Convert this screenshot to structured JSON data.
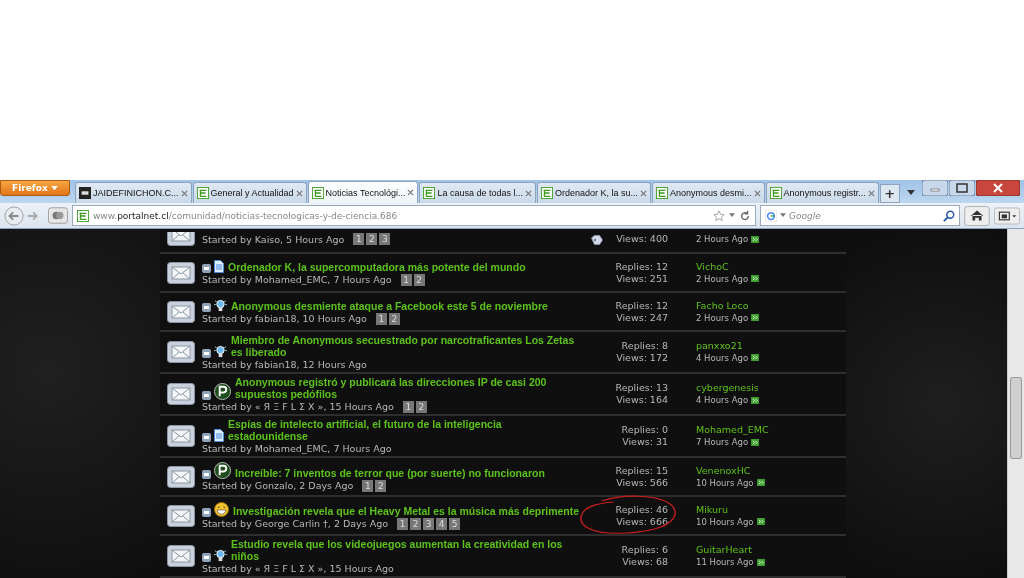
{
  "browser": {
    "menu_button": "Firefox",
    "tabs": [
      {
        "label": "JAIDEFINICHON.C...",
        "kind": "hd",
        "selected": false
      },
      {
        "label": "General y Actualidad",
        "kind": "site",
        "selected": false
      },
      {
        "label": "Noticias Tecnológi...",
        "kind": "site",
        "selected": true
      },
      {
        "label": "La causa de todas l...",
        "kind": "site",
        "selected": false
      },
      {
        "label": "Ordenador K, la su...",
        "kind": "site",
        "selected": false
      },
      {
        "label": "Anonymous desmi...",
        "kind": "site",
        "selected": false
      },
      {
        "label": "Anonymous registr...",
        "kind": "site",
        "selected": false
      }
    ],
    "new_tab": "+",
    "url": {
      "prefix": "www.",
      "domain": "portalnet.cl",
      "path": "/comunidad/noticias-tecnologicas-y-de-ciencia.686"
    },
    "search": {
      "placeholder": "Google"
    }
  },
  "threads": [
    {
      "kind": "cut",
      "starter": "Started by Kaiso, 5 Hours Ago",
      "pages": [
        "1",
        "2",
        "3"
      ],
      "tagged": true,
      "views": "Views: 400",
      "last_time": "2 Hours Ago",
      "circled": false
    },
    {
      "kind": "doc",
      "title": "Ordenador K, la supercomputadora más potente del mundo",
      "starter": "Started by Mohamed_EMC, 7 Hours Ago",
      "pages": [
        "1",
        "2"
      ],
      "tagged": false,
      "replies": "Replies: 12",
      "views": "Views: 251",
      "last_poster": "VichoC",
      "last_time": "2 Hours Ago",
      "circled": false
    },
    {
      "kind": "bulb",
      "title": "Anonymous desmiente ataque a Facebook este 5 de noviembre",
      "starter": "Started by fabian18, 10 Hours Ago",
      "pages": [
        "1",
        "2"
      ],
      "tagged": false,
      "replies": "Replies: 12",
      "views": "Views: 247",
      "last_poster": "Facho Loco",
      "last_time": "2 Hours Ago",
      "circled": false
    },
    {
      "kind": "bulb",
      "title": "Miembro de Anonymous secuestrado por narcotraficantes Los Zetas es liberado",
      "starter": "Started by fabian18, 12 Hours Ago",
      "tagged": false,
      "replies": "Replies: 8",
      "views": "Views: 172",
      "last_poster": "panxxo21",
      "last_time": "4 Hours Ago",
      "circled": false
    },
    {
      "kind": "p",
      "title": "Anonymous registró y publicará las direcciones IP de casi 200 supuestos pedófilos",
      "starter": "Started by « Я Ξ F L Σ Χ », 15 Hours Ago",
      "pages": [
        "1",
        "2"
      ],
      "tagged": false,
      "replies": "Replies: 13",
      "views": "Views: 164",
      "last_poster": "cybergenesis",
      "last_time": "4 Hours Ago",
      "circled": false
    },
    {
      "kind": "doc",
      "title": "Espías de intelecto artificial, el futuro de la inteligencia estadounidense",
      "starter": "Started by Mohamed_EMC, 7 Hours Ago",
      "tagged": false,
      "replies": "Replies: 0",
      "views": "Views: 31",
      "last_poster": "Mohamed_EMC",
      "last_time": "7 Hours Ago",
      "circled": false
    },
    {
      "kind": "p",
      "title": "Increíble: 7 inventos de terror que (por suerte) no funcionaron",
      "starter": "Started by Gonzalo, 2 Days Ago",
      "pages": [
        "1",
        "2"
      ],
      "tagged": false,
      "replies": "Replies: 15",
      "views": "Views: 566",
      "last_poster": "VenenoxHC",
      "last_time": "10 Hours Ago",
      "circled": false
    },
    {
      "kind": "laugh",
      "title": "Investigación revela que el Heavy Metal es la música más deprimente",
      "starter": "Started by George Carlin †, 2 Days Ago",
      "pages": [
        "1",
        "2",
        "3",
        "4",
        "5"
      ],
      "tagged": false,
      "replies": "Replies: 46",
      "views": "Views: 666",
      "last_poster": "Mikuru",
      "last_time": "10 Hours Ago",
      "circled": true
    },
    {
      "kind": "bulb",
      "title": "Estudio revela que los videojuegos aumentan la creatividad en los niños",
      "starter": "Started by « Я Ξ F L Σ Χ », 15 Hours Ago",
      "tagged": false,
      "replies": "Replies: 6",
      "views": "Views: 68",
      "last_poster": "GuitarHeart",
      "last_time": "11 Hours Ago",
      "circled": false
    }
  ]
}
